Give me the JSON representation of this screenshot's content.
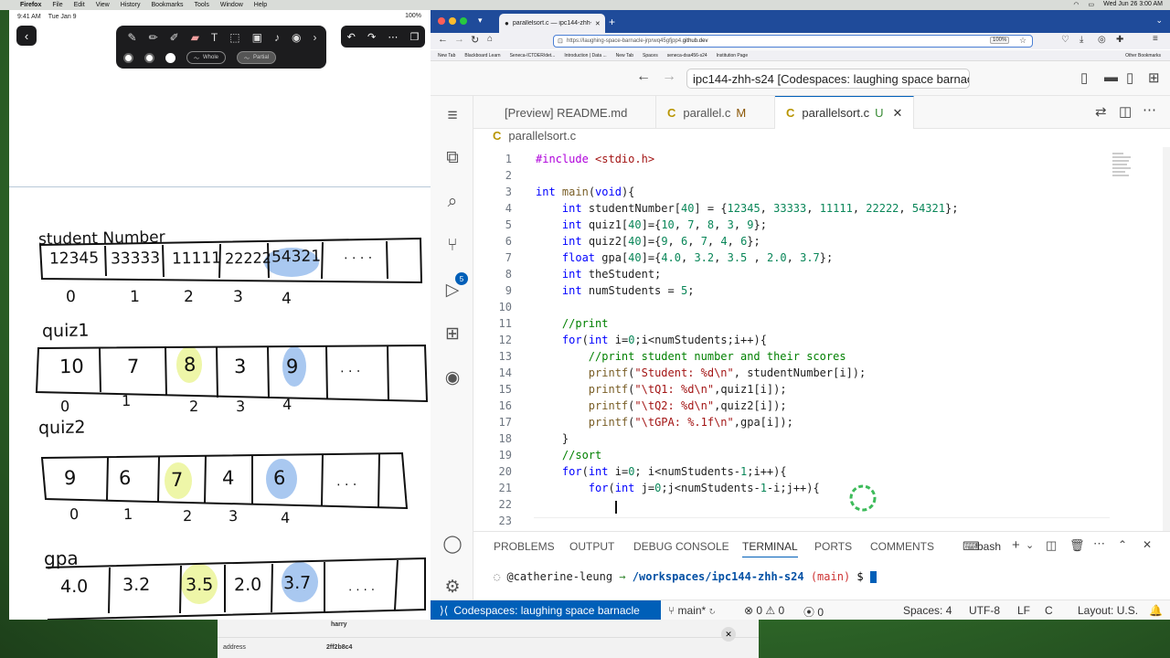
{
  "menubar": {
    "app": "Firefox",
    "items": [
      "File",
      "Edit",
      "View",
      "History",
      "Bookmarks",
      "Tools",
      "Window",
      "Help"
    ],
    "clock": "Wed Jun 26  3:00 AM"
  },
  "ipad": {
    "time": "9:41 AM",
    "date": "Tue Jan 9",
    "battery": "100%",
    "toolbar": {
      "whole_label": "Whole",
      "partial_label": "Partial"
    },
    "notes": {
      "student_label": "student Number",
      "student_values": [
        "12345",
        "33333",
        "11111",
        "22222",
        "54321",
        ". . . ."
      ],
      "student_indices": [
        "0",
        "1",
        "2",
        "3",
        "4"
      ],
      "quiz1_label": "quiz1",
      "quiz1_values": [
        "10",
        "7",
        "8",
        "3",
        "9",
        ". . ."
      ],
      "quiz1_indices": [
        "0",
        "1",
        "2",
        "3",
        "4"
      ],
      "quiz2_label": "quiz2",
      "quiz2_values": [
        "9",
        "6",
        "7",
        "4",
        "6",
        ". . ."
      ],
      "quiz2_indices": [
        "0",
        "1",
        "2",
        "3",
        "4"
      ],
      "gpa_label": "gpa",
      "gpa_values": [
        "4.0",
        "3.2",
        "3.5",
        "2.0",
        "3.7",
        ". . . ."
      ]
    }
  },
  "browser": {
    "tab_title": "parallelsort.c — ipc144-zhh-s24",
    "url_prefix": "https://laughing-space-barnacle-jrprwq45gfjpp4.",
    "url_domain": "github.dev",
    "zoom": "100%",
    "bookmarks": [
      "New Tab",
      "Blackboard Learn",
      "Seneca-ICTDER/det...",
      "Introduction | Data ...",
      "New Tab",
      "Spaces",
      "seneca-dsa456-s24",
      "Institution Page"
    ],
    "other_bookmarks": "Other Bookmarks"
  },
  "vscode": {
    "command_center": "ipc144-zhh-s24 [Codespaces: laughing space barnacle]",
    "tabs": [
      {
        "label": "[Preview] README.md",
        "mark": ""
      },
      {
        "label": "parallel.c",
        "mark": "M"
      },
      {
        "label": "parallelsort.c",
        "mark": "U"
      }
    ],
    "tab_c_glyph": "C",
    "breadcrumb": "parallelsort.c",
    "scm_badge": "5",
    "code_lines": [
      "1",
      "2",
      "3",
      "4",
      "5",
      "6",
      "7",
      "8",
      "9",
      "10",
      "11",
      "12",
      "13",
      "14",
      "15",
      "16",
      "17",
      "18",
      "19",
      "20",
      "21",
      "22",
      "23"
    ],
    "panel_tabs": [
      "PROBLEMS",
      "OUTPUT",
      "DEBUG CONSOLE",
      "TERMINAL",
      "PORTS",
      "COMMENTS"
    ],
    "shell": "bash",
    "terminal": {
      "user": "@catherine-leung",
      "arrow": "→",
      "path": "/workspaces/ipc144-zhh-s24",
      "branch": "(main)",
      "prompt": "$"
    },
    "status": {
      "remote": "Codespaces: laughing space barnacle",
      "branch": "main*",
      "errors": "0",
      "warnings": "0",
      "ports": "0",
      "spaces": "Spaces: 4",
      "encoding": "UTF-8",
      "eol": "LF",
      "language": "C",
      "layout": "Layout: U.S."
    }
  },
  "behind": {
    "row1_value": "harry",
    "row2_label": "address",
    "row2_value": "2ff2b8c4"
  },
  "colors": {
    "vscode_accent": "#005fb8",
    "browser_tabstrip": "#1f4b9a",
    "highlight_blue": "#a9c8f0",
    "highlight_yellow": "#eef6a8"
  }
}
